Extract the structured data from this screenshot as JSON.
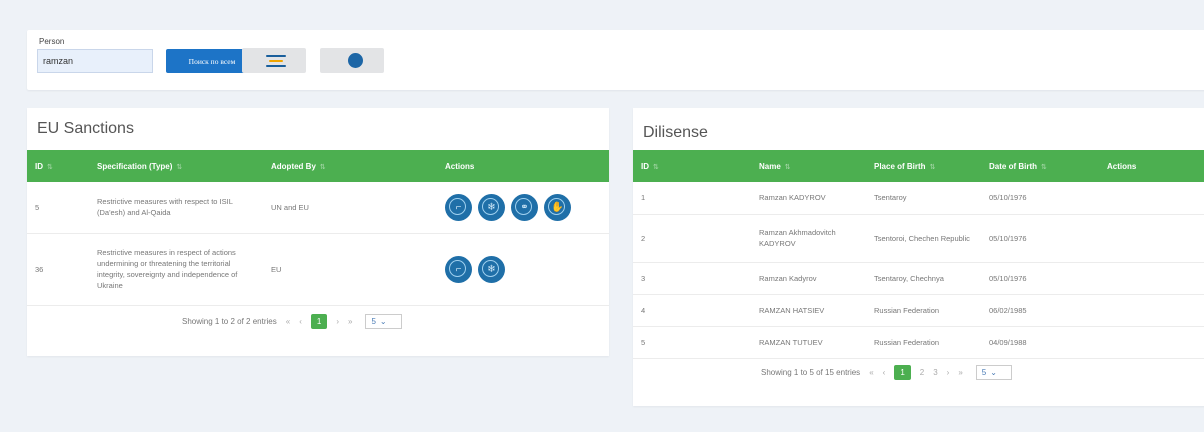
{
  "search": {
    "label": "Person",
    "value": "ramzan",
    "button_label": "Поиск по всем"
  },
  "colors": {
    "accent": "#4caf50",
    "primary": "#1d74c7",
    "icon": "#1f6fa8"
  },
  "eu": {
    "title": "EU Sanctions",
    "columns": [
      "ID",
      "Specification (Type)",
      "Adopted By",
      "Actions"
    ],
    "rows": [
      {
        "id": "5",
        "spec": "Restrictive measures with respect to ISIL (Da'esh) and Al-Qaida",
        "adopted": "UN and EU",
        "icons": [
          "gun-icon",
          "snowflake-icon",
          "handshake-icon",
          "hand-icon"
        ]
      },
      {
        "id": "36",
        "spec": "Restrictive measures in respect of actions undermining or threatening the territorial integrity, sovereignty and independence of Ukraine",
        "adopted": "EU",
        "icons": [
          "gun-icon",
          "snowflake-icon"
        ]
      }
    ],
    "pager": {
      "info": "Showing 1 to 2 of 2 entries",
      "pages": [
        "1"
      ],
      "active": "1",
      "page_size": "5"
    }
  },
  "dil": {
    "title": "Dilisense",
    "columns": [
      "ID",
      "Name",
      "Place of Birth",
      "Date of Birth",
      "Actions"
    ],
    "rows": [
      {
        "id": "1",
        "name": "Ramzan KADYROV",
        "place": "Tsentaroy",
        "dob": "05/10/1976"
      },
      {
        "id": "2",
        "name": "Ramzan Akhmadovitch KADYROV",
        "place": "Tsentoroi, Chechen Republic",
        "dob": "05/10/1976"
      },
      {
        "id": "3",
        "name": "Ramzan Kadyrov",
        "place": "Tsentaroy, Chechnya",
        "dob": "05/10/1976"
      },
      {
        "id": "4",
        "name": "RAMZAN HATSIEV",
        "place": "Russian Federation",
        "dob": "06/02/1985"
      },
      {
        "id": "5",
        "name": "RAMZAN TUTUEV",
        "place": "Russian Federation",
        "dob": "04/09/1988"
      }
    ],
    "pager": {
      "info": "Showing 1 to 5 of 15 entries",
      "pages": [
        "1",
        "2",
        "3"
      ],
      "active": "1",
      "page_size": "5"
    }
  }
}
